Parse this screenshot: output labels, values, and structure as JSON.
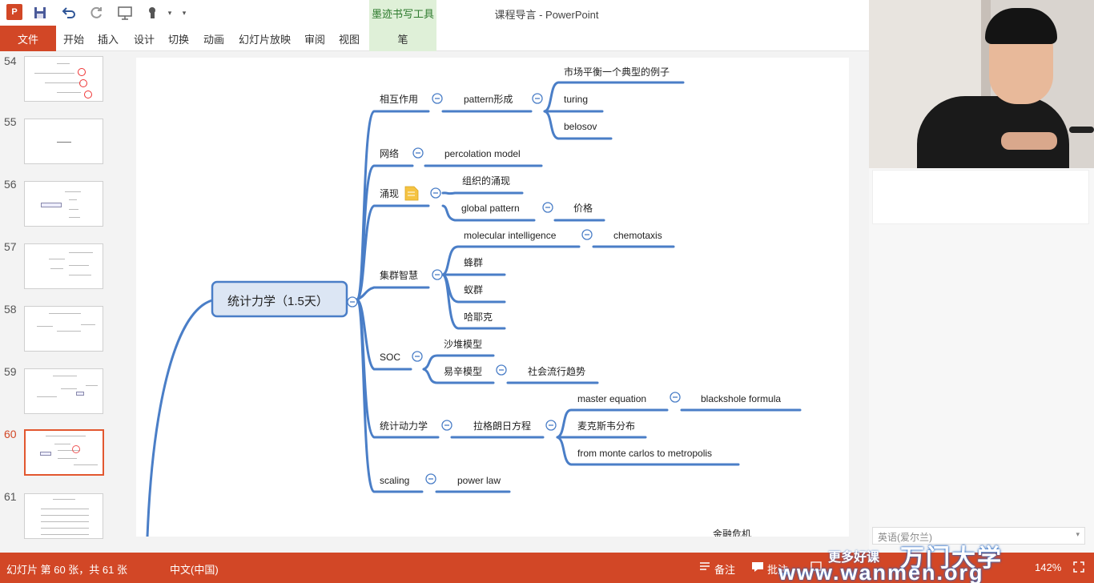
{
  "window": {
    "app_title": "课程导言 - PowerPoint",
    "ink_tools_title": "墨迹书写工具"
  },
  "ribbon": {
    "file": "文件",
    "tabs": [
      "开始",
      "插入",
      "设计",
      "切换",
      "动画",
      "幻灯片放映",
      "审阅",
      "视图"
    ],
    "pen": "笔"
  },
  "thumbnails": [
    {
      "num": "54"
    },
    {
      "num": "55"
    },
    {
      "num": "56"
    },
    {
      "num": "57"
    },
    {
      "num": "58"
    },
    {
      "num": "59"
    },
    {
      "num": "60",
      "active": true
    },
    {
      "num": "61"
    }
  ],
  "mindmap": {
    "root": "统计力学（1.5天）",
    "branches": {
      "interaction": "相互作用",
      "pattern": "pattern形成",
      "market": "市场平衡一个典型的例子",
      "turing": "turing",
      "belosov": "belosov",
      "network": "网络",
      "percolation": "percolation model",
      "emergence": "涌现",
      "org_emergence": "组织的涌现",
      "global_pattern": "global pattern",
      "price": "价格",
      "swarm": "集群智慧",
      "molecular": "molecular intelligence",
      "chemotaxis": "chemotaxis",
      "bee": "蜂群",
      "ant": "蚁群",
      "hayek": "哈耶克",
      "soc": "SOC",
      "sandpile": "沙堆模型",
      "ising": "易辛模型",
      "social_trend": "社会流行趋势",
      "stat_dyn": "统计动力学",
      "langevin": "拉格朗日方程",
      "master": "master equation",
      "black_scholes": "blackshole formula",
      "maxwell": "麦克斯韦分布",
      "monte_carlo": "from monte carlos to metropolis",
      "scaling": "scaling",
      "power_law": "power law",
      "partial": "金融危机"
    }
  },
  "right_panel": {
    "language": "英语(爱尔兰)"
  },
  "status": {
    "slide_info": "幻灯片 第 60 张，共 61 张",
    "language": "中文(中国)",
    "notes": "备注",
    "comments": "批注",
    "zoom": "142%"
  },
  "watermark": {
    "line1": "更多好课",
    "brand": "万门大学",
    "url": "www.wanmen.org"
  },
  "colors": {
    "accent": "#d24726",
    "connector": "#4a7ec7",
    "root_fill": "#dce6f4"
  },
  "icons": [
    "powerpoint-logo-icon",
    "save-icon",
    "undo-icon",
    "redo-icon",
    "slideshow-icon",
    "touch-mode-icon",
    "collapse-icon",
    "note-icon"
  ]
}
